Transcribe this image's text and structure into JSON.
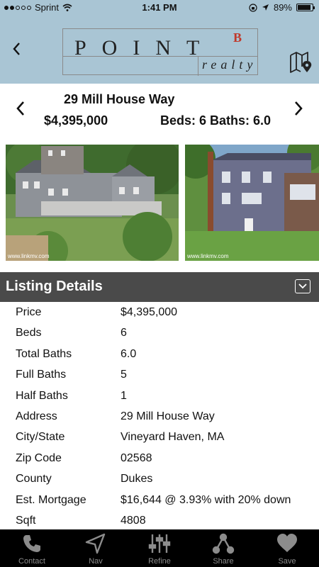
{
  "status_bar": {
    "carrier": "Sprint",
    "time": "1:41 PM",
    "battery": "89%",
    "battery_level": 0.89
  },
  "nav": {
    "logo_word": "POINT",
    "logo_b": "B",
    "logo_sub": "realty"
  },
  "listing": {
    "address": "29 Mill House Way",
    "price": "$4,395,000",
    "beds_baths": "Beds: 6  Baths: 6.0"
  },
  "photos": {
    "credit_1": "www.linkmv.com",
    "credit_2": "www.linkmv.com"
  },
  "details": {
    "title": "Listing Details",
    "rows": [
      {
        "label": "Price",
        "value": "$4,395,000"
      },
      {
        "label": "Beds",
        "value": "6"
      },
      {
        "label": "Total Baths",
        "value": "6.0"
      },
      {
        "label": "Full Baths",
        "value": "5"
      },
      {
        "label": "Half Baths",
        "value": "1"
      },
      {
        "label": "Address",
        "value": "29 Mill House Way"
      },
      {
        "label": "City/State",
        "value": "Vineyard Haven, MA"
      },
      {
        "label": "Zip Code",
        "value": "02568"
      },
      {
        "label": "County",
        "value": "Dukes"
      },
      {
        "label": "Est. Mortgage",
        "value": "$16,644 @ 3.93% with 20% down"
      },
      {
        "label": "Sqft",
        "value": "4808"
      }
    ]
  },
  "tabs": [
    {
      "label": "Contact",
      "icon": "phone-icon"
    },
    {
      "label": "Nav",
      "icon": "navigation-arrow-icon"
    },
    {
      "label": "Refine",
      "icon": "sliders-icon"
    },
    {
      "label": "Share",
      "icon": "share-icon"
    },
    {
      "label": "Save",
      "icon": "heart-icon"
    }
  ],
  "colors": {
    "header_bg": "#a9c5d4",
    "section_header_bg": "#4a4a4a",
    "tabbar_bg": "#000000",
    "logo_accent": "#c0392b"
  }
}
